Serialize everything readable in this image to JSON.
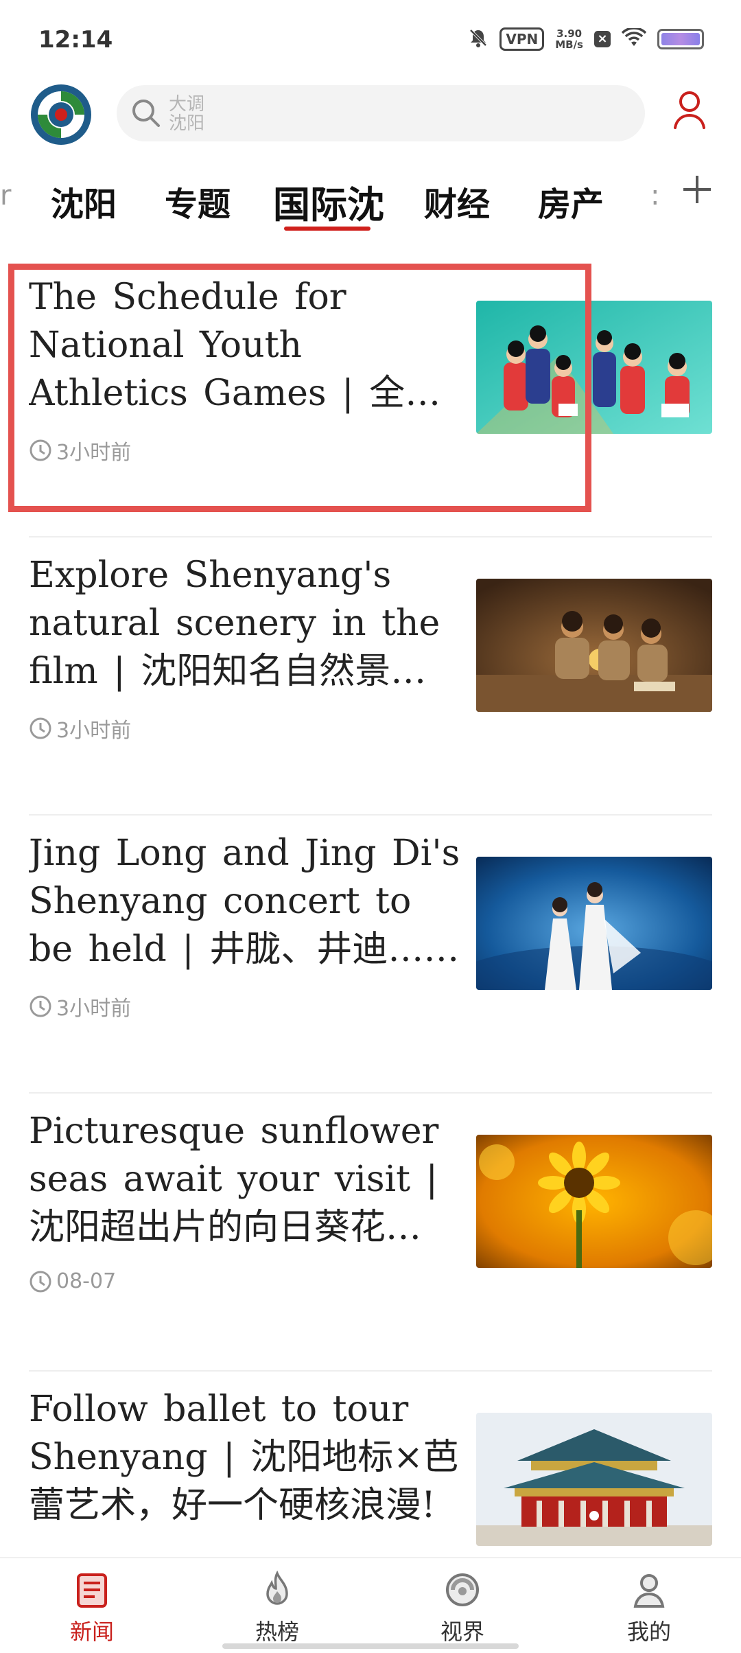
{
  "status_bar": {
    "time": "12:14",
    "vpn_label": "VPN",
    "speed_value": "3.90",
    "speed_unit": "MB/s",
    "icons": [
      "mute-bell-icon",
      "vpn-icon",
      "speed-readout",
      "notification-x-icon",
      "wifi-icon",
      "battery-icon"
    ]
  },
  "header": {
    "logo": "shenyang-logo",
    "search": {
      "hint_line1": "大调",
      "hint_line2": "沈阳"
    },
    "user_icon": "user-icon"
  },
  "tabs": {
    "left_fragment": "r",
    "items": [
      {
        "label": "沈阳"
      },
      {
        "label": "专题"
      },
      {
        "label": "国际沈"
      },
      {
        "label": "财经"
      },
      {
        "label": "房产"
      }
    ],
    "active_index": 2,
    "right_fragment": ":",
    "add_icon": "plus-icon"
  },
  "feed": {
    "items": [
      {
        "title": "The Schedule for National Youth Athletics Games | 全国青年田径运动会赛程",
        "time": "3小时前",
        "image": "athletes-photo"
      },
      {
        "title": "Explore Shenyang's natural scenery in the film | 沈阳知名自然景观……",
        "time": "3小时前",
        "image": "film-scene-photo"
      },
      {
        "title": "Jing Long and Jing Di's Shenyang concert to be held | 井胧、井迪……",
        "time": "3小时前",
        "image": "concert-photo"
      },
      {
        "title": "Picturesque sunflower seas await your visit | 沈阳超出片的向日葵花海……",
        "time": "08-07",
        "image": "sunflower-photo"
      },
      {
        "title": "Follow ballet to tour Shenyang | 沈阳地标×芭蕾艺术，好一个硬核浪漫!",
        "time": "",
        "image": "palace-photo"
      }
    ]
  },
  "bottom_nav": {
    "items": [
      {
        "label": "新闻",
        "icon": "news-icon"
      },
      {
        "label": "热榜",
        "icon": "flame-icon"
      },
      {
        "label": "视界",
        "icon": "vision-icon"
      },
      {
        "label": "我的",
        "icon": "profile-icon"
      }
    ],
    "active_index": 0
  },
  "colors": {
    "accent": "#c9201c",
    "highlight_border": "#e4524f",
    "muted_text": "#9a9a9a"
  }
}
